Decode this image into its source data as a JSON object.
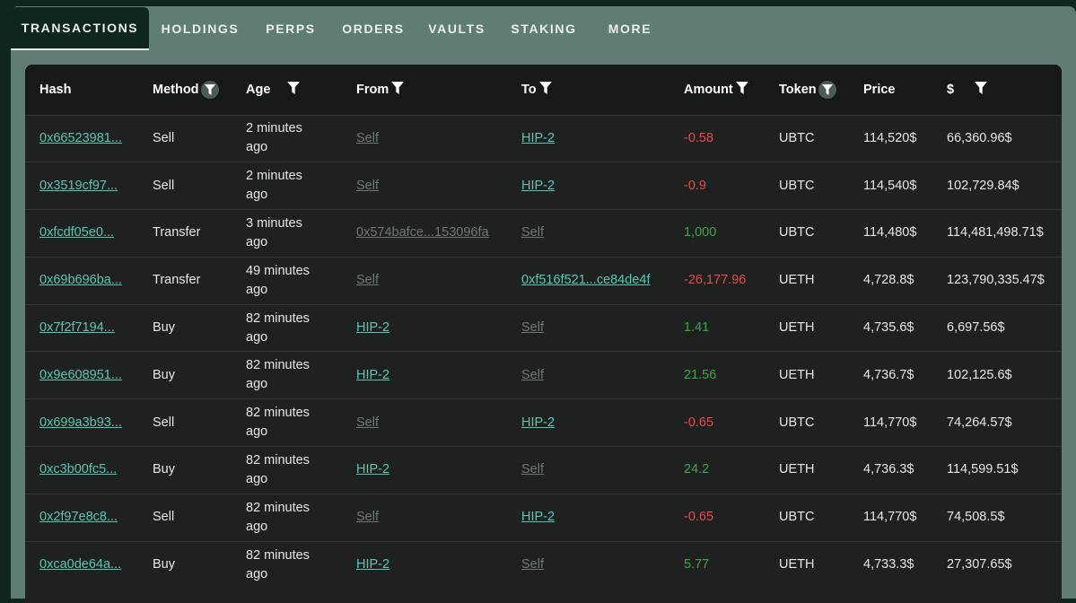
{
  "tabs": [
    "TRANSACTIONS",
    "HOLDINGS",
    "PERPS",
    "ORDERS",
    "VAULTS",
    "STAKING",
    "MORE"
  ],
  "columns": [
    "Hash",
    "Method",
    "Age",
    "From",
    "To",
    "Amount",
    "Token",
    "Price",
    "$"
  ],
  "rows": [
    {
      "hash": "0x66523981...",
      "method": "Sell",
      "age": "2 minutes ago",
      "from": "Self",
      "to": "HIP-2",
      "amount": "-0.58",
      "token": "UBTC",
      "price": "114,520$",
      "usd": "66,360.96$"
    },
    {
      "hash": "0x3519cf97...",
      "method": "Sell",
      "age": "2 minutes ago",
      "from": "Self",
      "to": "HIP-2",
      "amount": "-0.9",
      "token": "UBTC",
      "price": "114,540$",
      "usd": "102,729.84$"
    },
    {
      "hash": "0xfcdf05e0...",
      "method": "Transfer",
      "age": "3 minutes ago",
      "from": "0x574bafce...153096fa",
      "to": "Self",
      "amount": "1,000",
      "token": "UBTC",
      "price": "114,480$",
      "usd": "114,481,498.71$"
    },
    {
      "hash": "0x69b696ba...",
      "method": "Transfer",
      "age": "49 minutes ago",
      "from": "Self",
      "to": "0xf516f521...ce84de4f",
      "amount": "-26,177.96",
      "token": "UETH",
      "price": "4,728.8$",
      "usd": "123,790,335.47$"
    },
    {
      "hash": "0x7f2f7194...",
      "method": "Buy",
      "age": "82 minutes ago",
      "from": "HIP-2",
      "to": "Self",
      "amount": "1.41",
      "token": "UETH",
      "price": "4,735.6$",
      "usd": "6,697.56$"
    },
    {
      "hash": "0x9e608951...",
      "method": "Buy",
      "age": "82 minutes ago",
      "from": "HIP-2",
      "to": "Self",
      "amount": "21.56",
      "token": "UETH",
      "price": "4,736.7$",
      "usd": "102,125.6$"
    },
    {
      "hash": "0x699a3b93...",
      "method": "Sell",
      "age": "82 minutes ago",
      "from": "Self",
      "to": "HIP-2",
      "amount": "-0.65",
      "token": "UBTC",
      "price": "114,770$",
      "usd": "74,264.57$"
    },
    {
      "hash": "0xc3b00fc5...",
      "method": "Buy",
      "age": "82 minutes ago",
      "from": "HIP-2",
      "to": "Self",
      "amount": "24.2",
      "token": "UETH",
      "price": "4,736.3$",
      "usd": "114,599.51$"
    },
    {
      "hash": "0x2f97e8c8...",
      "method": "Sell",
      "age": "82 minutes ago",
      "from": "Self",
      "to": "HIP-2",
      "amount": "-0.65",
      "token": "UBTC",
      "price": "114,770$",
      "usd": "74,508.5$"
    },
    {
      "hash": "0xca0de64a...",
      "method": "Buy",
      "age": "82 minutes ago",
      "from": "HIP-2",
      "to": "Self",
      "amount": "5.77",
      "token": "UETH",
      "price": "4,733.3$",
      "usd": "27,307.65$"
    }
  ],
  "colors": {
    "link": "#58c7b0",
    "negative": "#e8484b",
    "positive": "#3fa34a",
    "muted": "#6f7775"
  }
}
